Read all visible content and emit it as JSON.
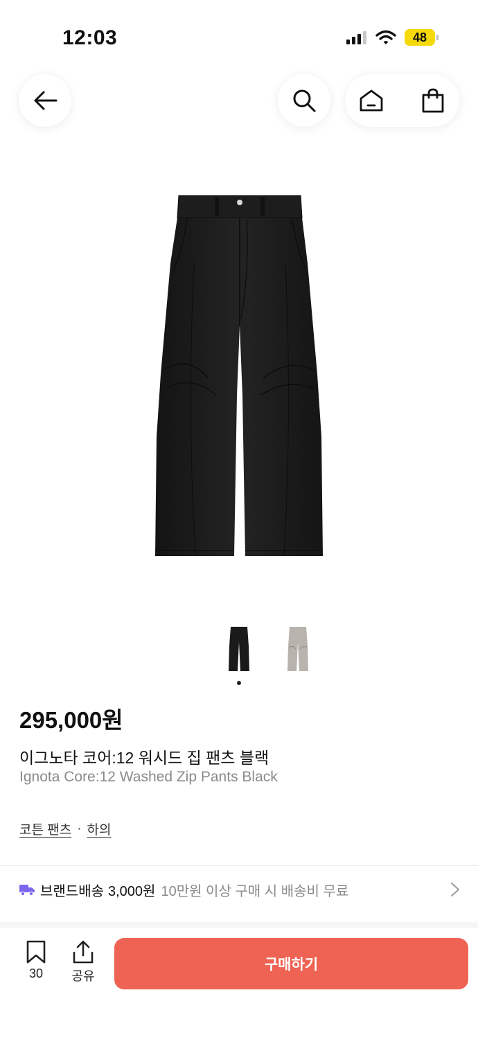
{
  "status_bar": {
    "time": "12:03",
    "battery": "48"
  },
  "nav": {
    "back_icon": "arrow-left-icon",
    "search_icon": "search-icon",
    "home_icon": "home-icon",
    "cart_icon": "shopping-bag-icon"
  },
  "gallery": {
    "current_index": 1,
    "thumbnails": [
      "black",
      "gray"
    ]
  },
  "product": {
    "price": "295,000원",
    "name_ko": "이그노타 코어:12 워시드 집 팬츠 블랙",
    "name_en": "Ignota Core:12 Washed Zip Pants Black",
    "categories": [
      "코튼 팬츠",
      "하의"
    ],
    "category_separator": "·"
  },
  "shipping": {
    "label": "브랜드배송",
    "price": "3,000원",
    "note": "10만원 이상 구매 시 배송비 무료",
    "icon": "truck-icon",
    "icon_color": "#7b68ee"
  },
  "bottom_bar": {
    "bookmark_count": "30",
    "share_label": "공유",
    "buy_label": "구매하기",
    "buy_color": "#ee6353"
  }
}
